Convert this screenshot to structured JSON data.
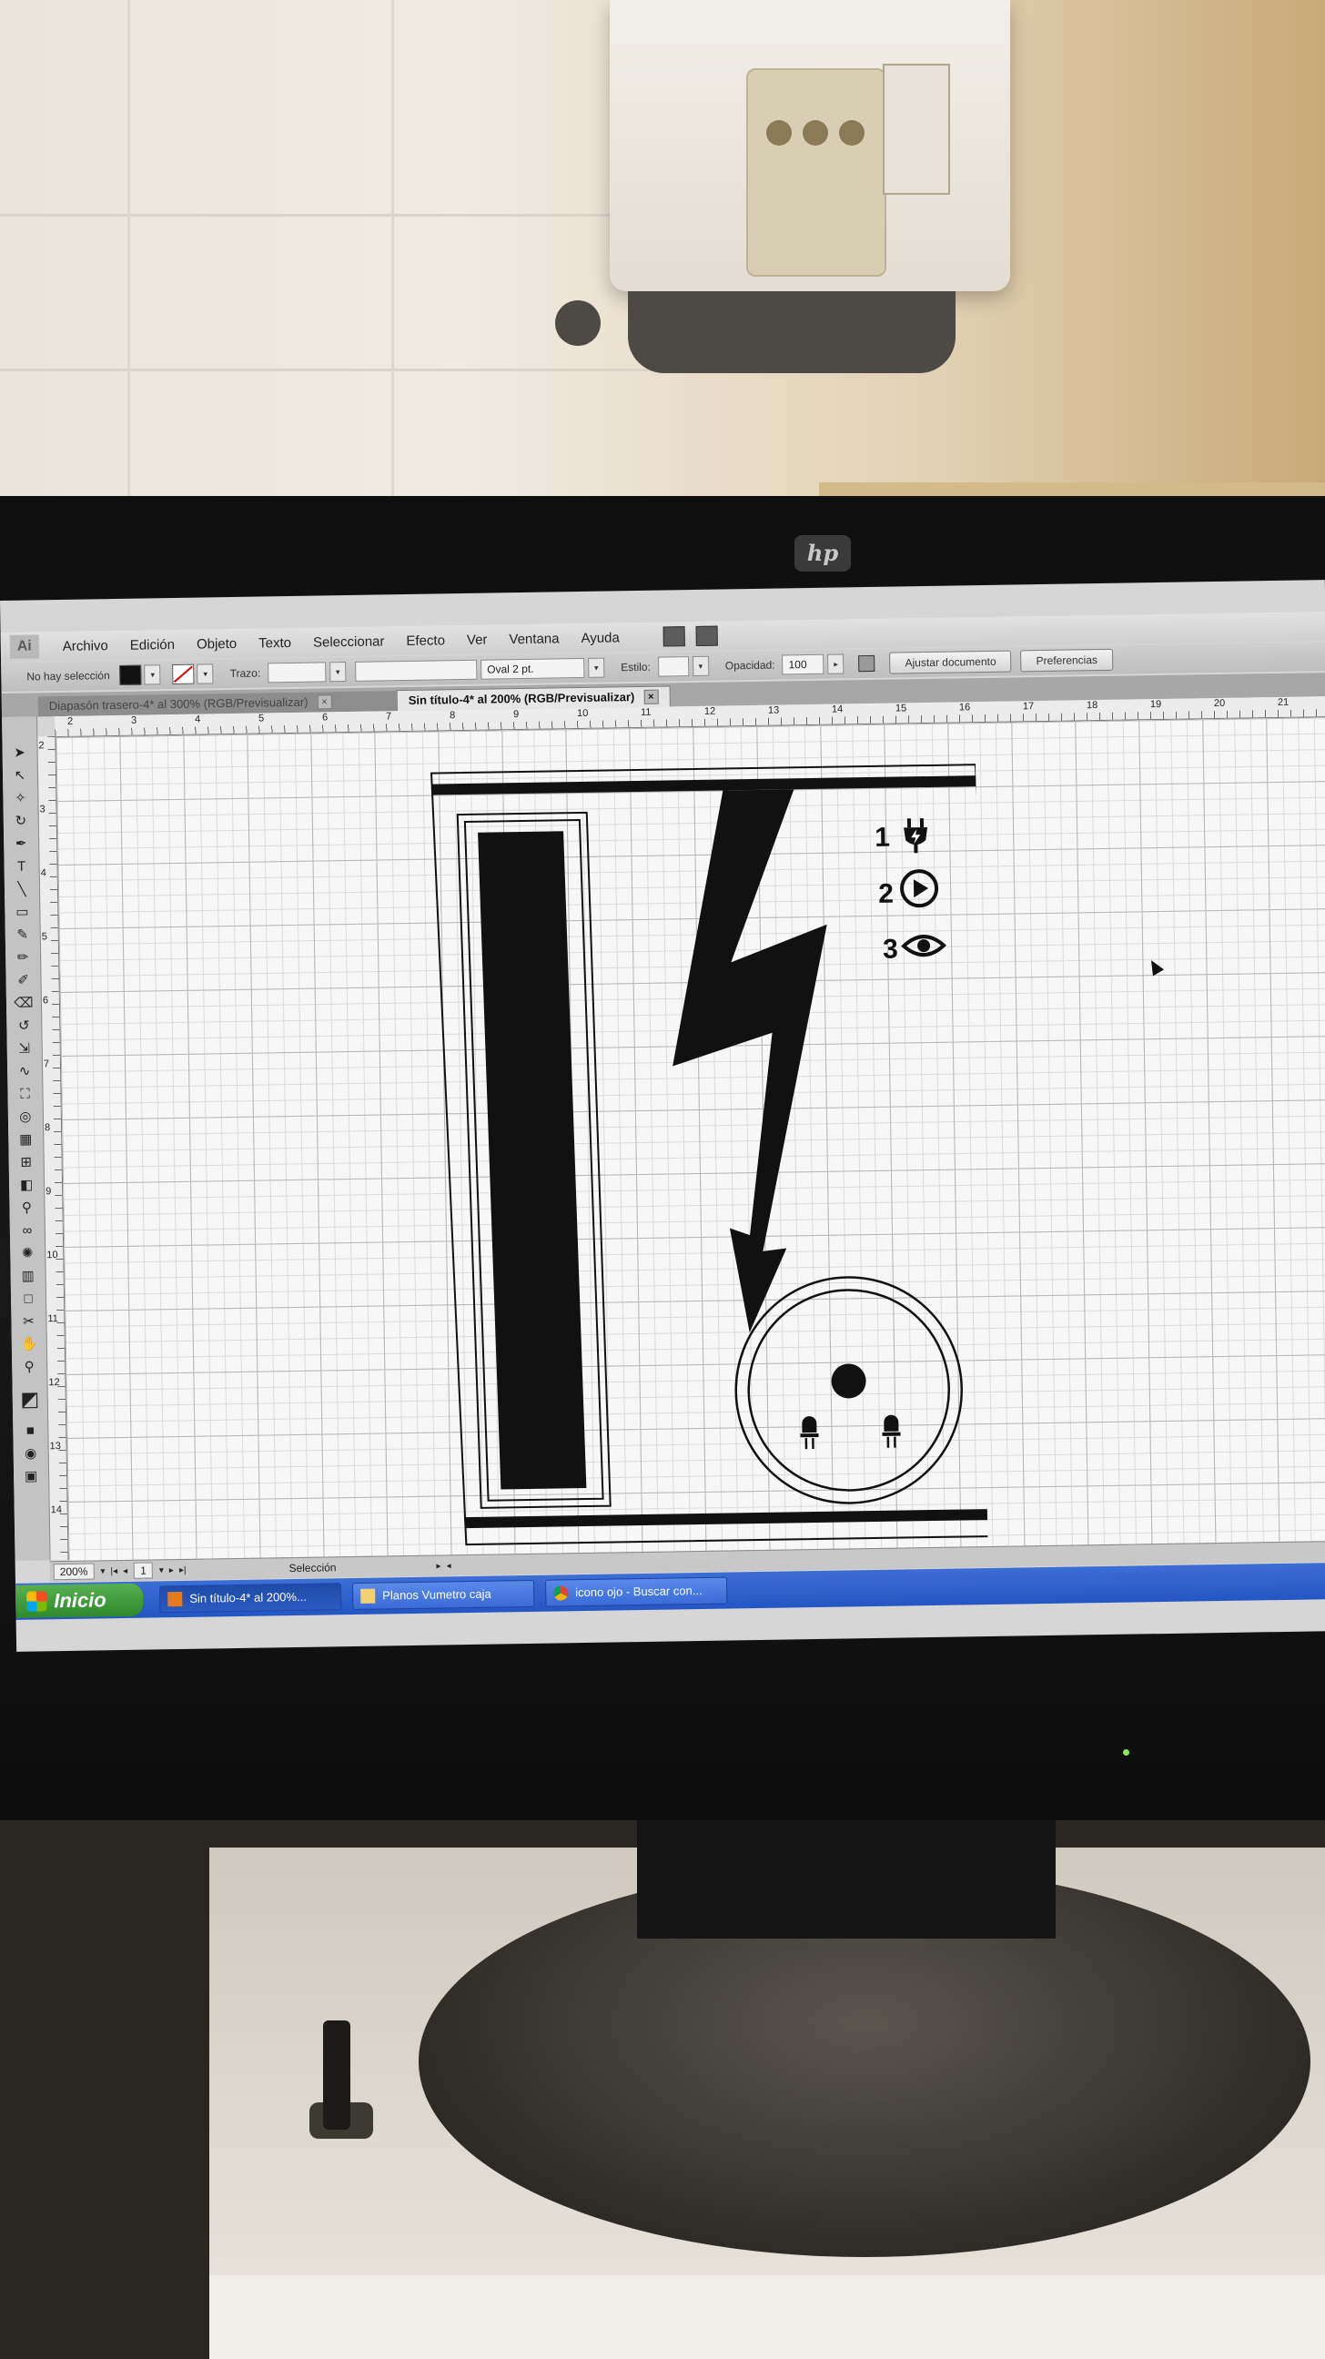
{
  "window": {
    "menu": [
      "Archivo",
      "Edición",
      "Objeto",
      "Texto",
      "Seleccionar",
      "Efecto",
      "Ver",
      "Ventana",
      "Ayuda"
    ],
    "app_logo": "Ai"
  },
  "control_bar": {
    "selection_status": "No hay selección",
    "stroke_label": "Trazo:",
    "brush_value": "Oval 2 pt.",
    "style_label": "Estilo:",
    "opacity_label": "Opacidad:",
    "opacity_value": "100",
    "fit_document_button": "Ajustar documento",
    "preferences_button": "Preferencias"
  },
  "tabs": [
    {
      "label": "Diapasón trasero-4* al 300% (RGB/Previsualizar)",
      "active": false
    },
    {
      "label": "Sin título-4* al 200% (RGB/Previsualizar)",
      "active": true
    }
  ],
  "ruler": {
    "horizontal": [
      "2",
      "3",
      "4",
      "5",
      "6",
      "7",
      "8",
      "9",
      "10",
      "11",
      "12",
      "13",
      "14",
      "15",
      "16",
      "17",
      "18",
      "19",
      "20",
      "21"
    ],
    "vertical": [
      "2",
      "3",
      "4",
      "5",
      "6",
      "7",
      "8",
      "9",
      "10",
      "11",
      "12",
      "13",
      "14"
    ]
  },
  "artwork": {
    "legend": [
      {
        "number": "1",
        "icon": "plug-icon"
      },
      {
        "number": "2",
        "icon": "play-icon"
      },
      {
        "number": "3",
        "icon": "eye-icon"
      }
    ]
  },
  "status_bar": {
    "zoom": "200%",
    "page": "1",
    "tool": "Selección"
  },
  "taskbar": {
    "start": "Inicio",
    "tasks": [
      {
        "label": "Sin título-4* al 200%...",
        "active": true
      },
      {
        "label": "Planos Vumetro caja",
        "active": false
      },
      {
        "label": "icono ojo - Buscar con...",
        "active": false
      }
    ]
  },
  "colors": {
    "artwork_ink": "#111111",
    "taskbar": "#2456c4",
    "start_button": "#2f8a2c"
  }
}
